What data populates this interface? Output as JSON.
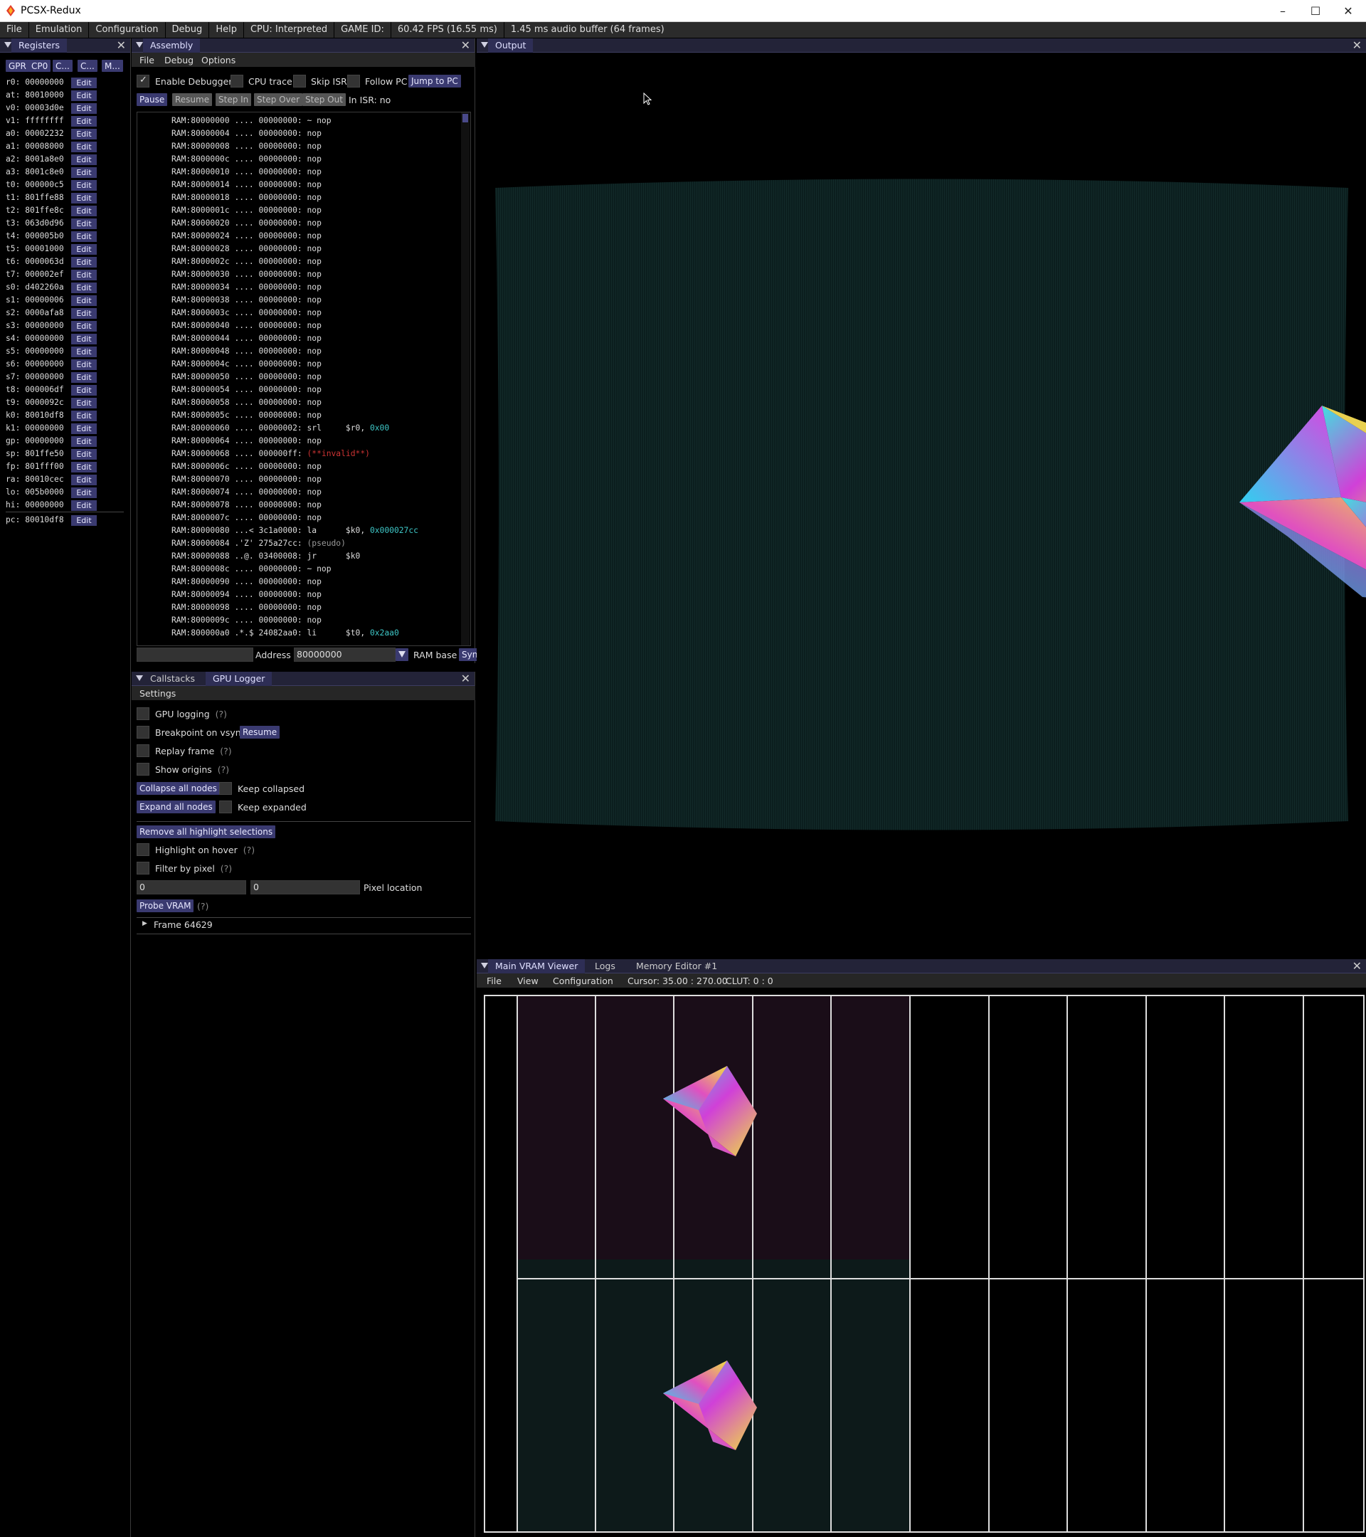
{
  "window": {
    "title": "PCSX-Redux"
  },
  "menubar": {
    "items": [
      "File",
      "Emulation",
      "Configuration",
      "Debug",
      "Help"
    ],
    "cpu": "CPU: Interpreted",
    "game_id": "GAME ID:",
    "fps": "60.42 FPS (16.55 ms)",
    "audio": "1.45 ms audio buffer (64 frames)"
  },
  "registers": {
    "title": "Registers",
    "tabs": [
      "GPR",
      "CP0",
      "C...",
      "C...",
      "M..."
    ],
    "edit_label": "Edit",
    "rows": [
      {
        "name": "r0:",
        "value": "00000000"
      },
      {
        "name": "at:",
        "value": "80010000"
      },
      {
        "name": "v0:",
        "value": "00003d0e"
      },
      {
        "name": "v1:",
        "value": "ffffffff"
      },
      {
        "name": "a0:",
        "value": "00002232"
      },
      {
        "name": "a1:",
        "value": "00008000"
      },
      {
        "name": "a2:",
        "value": "8001a8e0"
      },
      {
        "name": "a3:",
        "value": "8001c8e0"
      },
      {
        "name": "t0:",
        "value": "000000c5"
      },
      {
        "name": "t1:",
        "value": "801ffe88"
      },
      {
        "name": "t2:",
        "value": "801ffe8c"
      },
      {
        "name": "t3:",
        "value": "063d0d96"
      },
      {
        "name": "t4:",
        "value": "000005b0"
      },
      {
        "name": "t5:",
        "value": "00001000"
      },
      {
        "name": "t6:",
        "value": "0000063d"
      },
      {
        "name": "t7:",
        "value": "000002ef"
      },
      {
        "name": "s0:",
        "value": "d402260a"
      },
      {
        "name": "s1:",
        "value": "00000006"
      },
      {
        "name": "s2:",
        "value": "0000afa8"
      },
      {
        "name": "s3:",
        "value": "00000000"
      },
      {
        "name": "s4:",
        "value": "00000000"
      },
      {
        "name": "s5:",
        "value": "00000000"
      },
      {
        "name": "s6:",
        "value": "00000000"
      },
      {
        "name": "s7:",
        "value": "00000000"
      },
      {
        "name": "t8:",
        "value": "000006df"
      },
      {
        "name": "t9:",
        "value": "0000092c"
      },
      {
        "name": "k0:",
        "value": "80010df8"
      },
      {
        "name": "k1:",
        "value": "00000000"
      },
      {
        "name": "gp:",
        "value": "00000000"
      },
      {
        "name": "sp:",
        "value": "801ffe50"
      },
      {
        "name": "fp:",
        "value": "801fff00"
      },
      {
        "name": "ra:",
        "value": "80010cec"
      },
      {
        "name": "lo:",
        "value": "005b0000"
      },
      {
        "name": "hi:",
        "value": "00000000"
      }
    ],
    "pc": {
      "name": "pc:",
      "value": "80010df8"
    }
  },
  "assembly": {
    "title": "Assembly",
    "menu": [
      "File",
      "Debug",
      "Options"
    ],
    "enable_debugger": "Enable Debugger",
    "cpu_trace": "CPU trace",
    "skip_isr": "Skip ISR",
    "follow_pc": "Follow PC",
    "jump_to_pc": "Jump to PC",
    "pause": "Pause",
    "resume": "Resume",
    "step_in": "Step In",
    "step_over": "Step Over",
    "step_out": "Step Out",
    "in_isr": "In ISR: no",
    "lines": [
      {
        "addr": "RAM:80000000",
        "bytes": "....",
        "word": "00000000:",
        "op": "~ nop",
        "arg": "",
        "hex": "",
        "cls": ""
      },
      {
        "addr": "RAM:80000004",
        "bytes": "....",
        "word": "00000000:",
        "op": "nop",
        "arg": "",
        "hex": "",
        "cls": ""
      },
      {
        "addr": "RAM:80000008",
        "bytes": "....",
        "word": "00000000:",
        "op": "nop",
        "arg": "",
        "hex": "",
        "cls": ""
      },
      {
        "addr": "RAM:8000000c",
        "bytes": "....",
        "word": "00000000:",
        "op": "nop",
        "arg": "",
        "hex": "",
        "cls": ""
      },
      {
        "addr": "RAM:80000010",
        "bytes": "....",
        "word": "00000000:",
        "op": "nop",
        "arg": "",
        "hex": "",
        "cls": ""
      },
      {
        "addr": "RAM:80000014",
        "bytes": "....",
        "word": "00000000:",
        "op": "nop",
        "arg": "",
        "hex": "",
        "cls": ""
      },
      {
        "addr": "RAM:80000018",
        "bytes": "....",
        "word": "00000000:",
        "op": "nop",
        "arg": "",
        "hex": "",
        "cls": ""
      },
      {
        "addr": "RAM:8000001c",
        "bytes": "....",
        "word": "00000000:",
        "op": "nop",
        "arg": "",
        "hex": "",
        "cls": ""
      },
      {
        "addr": "RAM:80000020",
        "bytes": "....",
        "word": "00000000:",
        "op": "nop",
        "arg": "",
        "hex": "",
        "cls": ""
      },
      {
        "addr": "RAM:80000024",
        "bytes": "....",
        "word": "00000000:",
        "op": "nop",
        "arg": "",
        "hex": "",
        "cls": ""
      },
      {
        "addr": "RAM:80000028",
        "bytes": "....",
        "word": "00000000:",
        "op": "nop",
        "arg": "",
        "hex": "",
        "cls": ""
      },
      {
        "addr": "RAM:8000002c",
        "bytes": "....",
        "word": "00000000:",
        "op": "nop",
        "arg": "",
        "hex": "",
        "cls": ""
      },
      {
        "addr": "RAM:80000030",
        "bytes": "....",
        "word": "00000000:",
        "op": "nop",
        "arg": "",
        "hex": "",
        "cls": ""
      },
      {
        "addr": "RAM:80000034",
        "bytes": "....",
        "word": "00000000:",
        "op": "nop",
        "arg": "",
        "hex": "",
        "cls": ""
      },
      {
        "addr": "RAM:80000038",
        "bytes": "....",
        "word": "00000000:",
        "op": "nop",
        "arg": "",
        "hex": "",
        "cls": ""
      },
      {
        "addr": "RAM:8000003c",
        "bytes": "....",
        "word": "00000000:",
        "op": "nop",
        "arg": "",
        "hex": "",
        "cls": ""
      },
      {
        "addr": "RAM:80000040",
        "bytes": "....",
        "word": "00000000:",
        "op": "nop",
        "arg": "",
        "hex": "",
        "cls": ""
      },
      {
        "addr": "RAM:80000044",
        "bytes": "....",
        "word": "00000000:",
        "op": "nop",
        "arg": "",
        "hex": "",
        "cls": ""
      },
      {
        "addr": "RAM:80000048",
        "bytes": "....",
        "word": "00000000:",
        "op": "nop",
        "arg": "",
        "hex": "",
        "cls": ""
      },
      {
        "addr": "RAM:8000004c",
        "bytes": "....",
        "word": "00000000:",
        "op": "nop",
        "arg": "",
        "hex": "",
        "cls": ""
      },
      {
        "addr": "RAM:80000050",
        "bytes": "....",
        "word": "00000000:",
        "op": "nop",
        "arg": "",
        "hex": "",
        "cls": ""
      },
      {
        "addr": "RAM:80000054",
        "bytes": "....",
        "word": "00000000:",
        "op": "nop",
        "arg": "",
        "hex": "",
        "cls": ""
      },
      {
        "addr": "RAM:80000058",
        "bytes": "....",
        "word": "00000000:",
        "op": "nop",
        "arg": "",
        "hex": "",
        "cls": ""
      },
      {
        "addr": "RAM:8000005c",
        "bytes": "....",
        "word": "00000000:",
        "op": "nop",
        "arg": "",
        "hex": "",
        "cls": ""
      },
      {
        "addr": "RAM:80000060",
        "bytes": "....",
        "word": "00000002:",
        "op": "srl     ",
        "arg": "$r0, ",
        "hex": "0x00",
        "cls": ""
      },
      {
        "addr": "RAM:80000064",
        "bytes": "....",
        "word": "00000000:",
        "op": "nop",
        "arg": "",
        "hex": "",
        "cls": ""
      },
      {
        "addr": "RAM:80000068",
        "bytes": "....",
        "word": "000000ff:",
        "op": "(**invalid**)",
        "arg": "",
        "hex": "",
        "cls": "inv"
      },
      {
        "addr": "RAM:8000006c",
        "bytes": "....",
        "word": "00000000:",
        "op": "nop",
        "arg": "",
        "hex": "",
        "cls": ""
      },
      {
        "addr": "RAM:80000070",
        "bytes": "....",
        "word": "00000000:",
        "op": "nop",
        "arg": "",
        "hex": "",
        "cls": ""
      },
      {
        "addr": "RAM:80000074",
        "bytes": "....",
        "word": "00000000:",
        "op": "nop",
        "arg": "",
        "hex": "",
        "cls": ""
      },
      {
        "addr": "RAM:80000078",
        "bytes": "....",
        "word": "00000000:",
        "op": "nop",
        "arg": "",
        "hex": "",
        "cls": ""
      },
      {
        "addr": "RAM:8000007c",
        "bytes": "....",
        "word": "00000000:",
        "op": "nop",
        "arg": "",
        "hex": "",
        "cls": ""
      },
      {
        "addr": "RAM:80000080",
        "bytes": "...<",
        "word": "3c1a0000:",
        "op": "la      ",
        "arg": "$k0, ",
        "hex": "0x000027cc",
        "cls": ""
      },
      {
        "addr": "RAM:80000084",
        "bytes": ".'Z'",
        "word": "275a27cc:",
        "op": "(pseudo)",
        "arg": "",
        "hex": "",
        "cls": "pse"
      },
      {
        "addr": "RAM:80000088",
        "bytes": "..@.",
        "word": "03400008:",
        "op": "jr      ",
        "arg": "$k0",
        "hex": "",
        "cls": ""
      },
      {
        "addr": "RAM:8000008c",
        "bytes": "....",
        "word": "00000000:",
        "op": "~ nop",
        "arg": "",
        "hex": "",
        "cls": ""
      },
      {
        "addr": "RAM:80000090",
        "bytes": "....",
        "word": "00000000:",
        "op": "nop",
        "arg": "",
        "hex": "",
        "cls": ""
      },
      {
        "addr": "RAM:80000094",
        "bytes": "....",
        "word": "00000000:",
        "op": "nop",
        "arg": "",
        "hex": "",
        "cls": ""
      },
      {
        "addr": "RAM:80000098",
        "bytes": "....",
        "word": "00000000:",
        "op": "nop",
        "arg": "",
        "hex": "",
        "cls": ""
      },
      {
        "addr": "RAM:8000009c",
        "bytes": "....",
        "word": "00000000:",
        "op": "nop",
        "arg": "",
        "hex": "",
        "cls": ""
      },
      {
        "addr": "RAM:800000a0",
        "bytes": ".*.$",
        "word": "24082aa0:",
        "op": "li      ",
        "arg": "$t0, ",
        "hex": "0x2aa0",
        "cls": ""
      }
    ],
    "address_label": "Address",
    "address_value": "80000000",
    "ram_base": "RAM base",
    "sync": "Syn"
  },
  "gpu": {
    "tabs": [
      "Callstacks",
      "GPU Logger"
    ],
    "settings": "Settings",
    "gpu_logging": "GPU logging",
    "hint": "(?)",
    "breakpoint_vsync": "Breakpoint on vsync",
    "resume": "Resume",
    "replay_frame": "Replay frame",
    "show_origins": "Show origins",
    "collapse_all": "Collapse all nodes",
    "keep_collapsed": "Keep collapsed",
    "expand_all": "Expand all nodes",
    "keep_expanded": "Keep expanded",
    "remove_highlights": "Remove all highlight selections",
    "highlight_hover": "Highlight on hover",
    "filter_pixel": "Filter by pixel",
    "pixel_x": "0",
    "pixel_y": "0",
    "pixel_location": "Pixel location",
    "probe_vram": "Probe VRAM",
    "frame": "Frame 64629"
  },
  "output": {
    "title": "Output"
  },
  "vram": {
    "tabs": [
      "Main VRAM Viewer",
      "Logs",
      "Memory Editor #1"
    ],
    "menu": [
      "File",
      "View",
      "Configuration"
    ],
    "cursor": "Cursor: 35.00 : 270.00",
    "clut": "CLUT: 0 : 0"
  },
  "colors": {
    "accent": "#3a3a70",
    "title_bg": "#232338",
    "active_tab": "#2e2e55",
    "hex_text": "#3ec7c7",
    "invalid_text": "#cc3333"
  }
}
